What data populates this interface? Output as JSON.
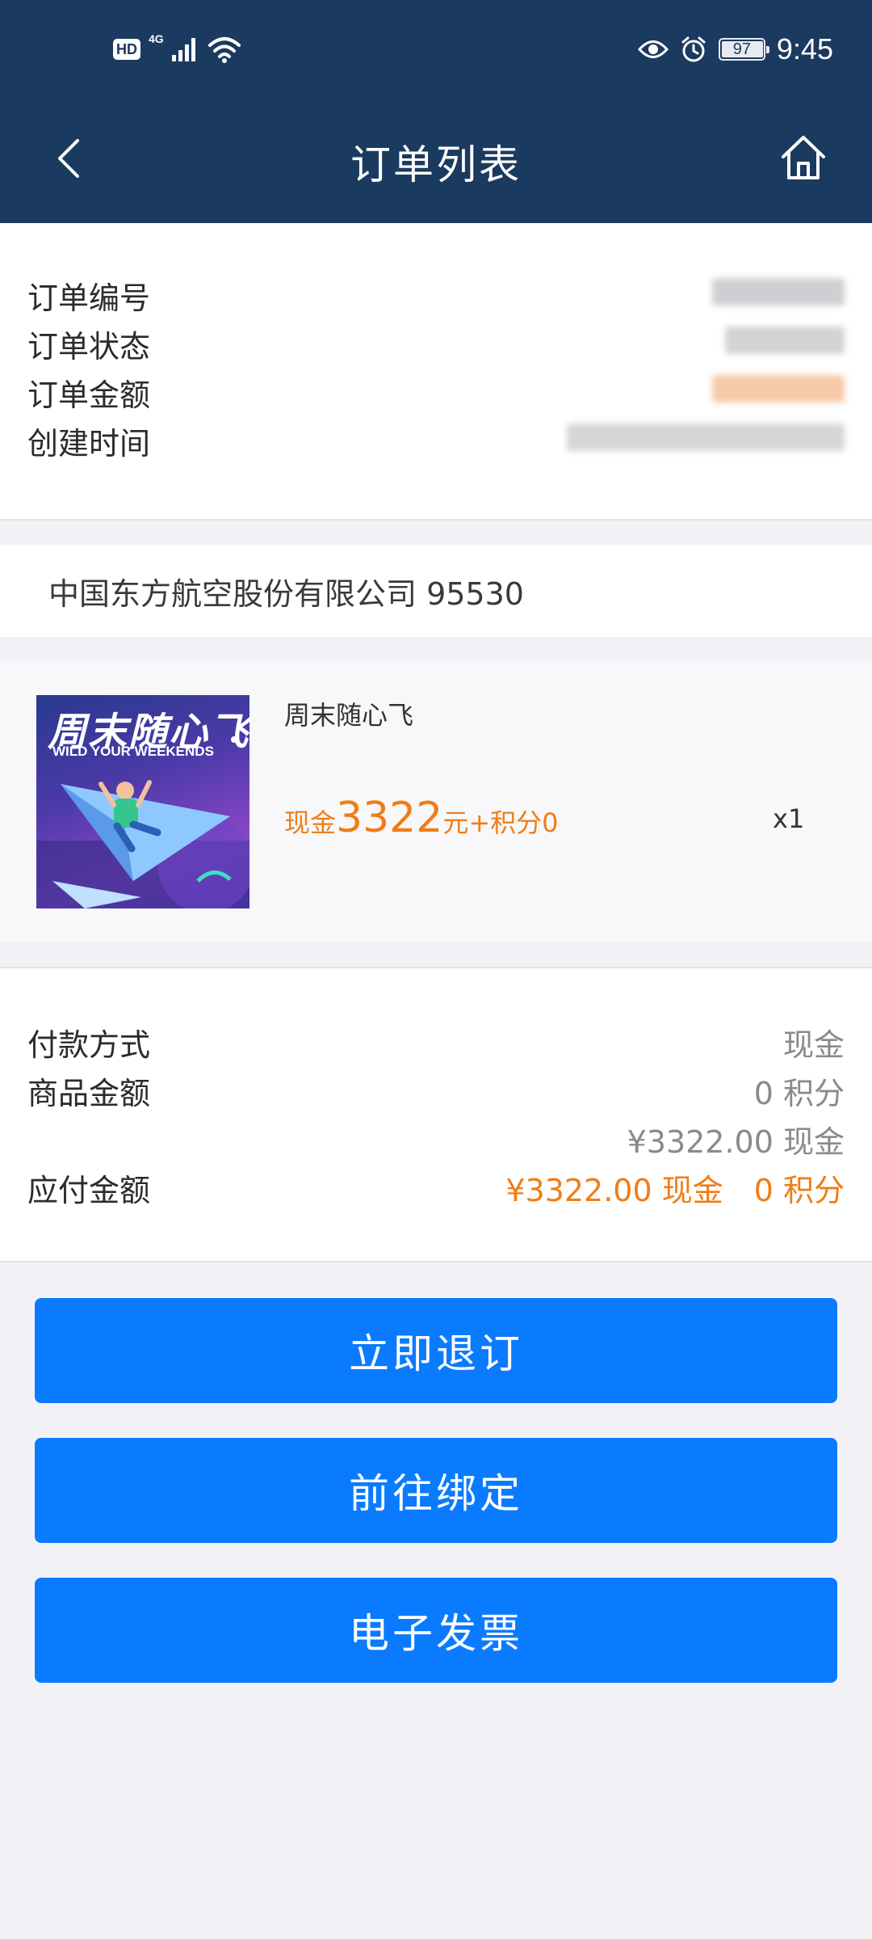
{
  "status_bar": {
    "hd_label": "HD",
    "network_label": "4G",
    "battery_percent": "97",
    "time": "9:45",
    "icons": [
      "signal-icon",
      "wifi-icon",
      "eye-icon",
      "alarm-icon",
      "battery-icon"
    ]
  },
  "nav": {
    "title": "订单列表",
    "back_icon": "chevron-left-icon",
    "home_icon": "home-icon"
  },
  "order_info": {
    "order_no_label": "订单编号",
    "status_label": "订单状态",
    "amount_label": "订单金额",
    "created_label": "创建时间"
  },
  "merchant": {
    "name": "中国东方航空股份有限公司 95530"
  },
  "product": {
    "image_title": "周末随心飞",
    "image_subtitle": "WILD YOUR WEEKENDS",
    "name": "周末随心飞",
    "price_prefix": "现金",
    "price_value": "3322",
    "price_suffix": "元+积分0",
    "quantity": "x1"
  },
  "payment": {
    "method_label": "付款方式",
    "method_value": "现金",
    "goods_label": "商品金额",
    "goods_points": "0 积分",
    "goods_cash": "¥3322.00 现金",
    "due_label": "应付金额",
    "due_value": "¥3322.00 现金　0 积分"
  },
  "buttons": {
    "cancel": "立即退订",
    "bind": "前往绑定",
    "invoice": "电子发票"
  },
  "colors": {
    "header_bg": "#1b3a60",
    "accent_orange": "#f07d16",
    "button_blue": "#0a7bff",
    "page_bg": "#f2f2f6"
  }
}
